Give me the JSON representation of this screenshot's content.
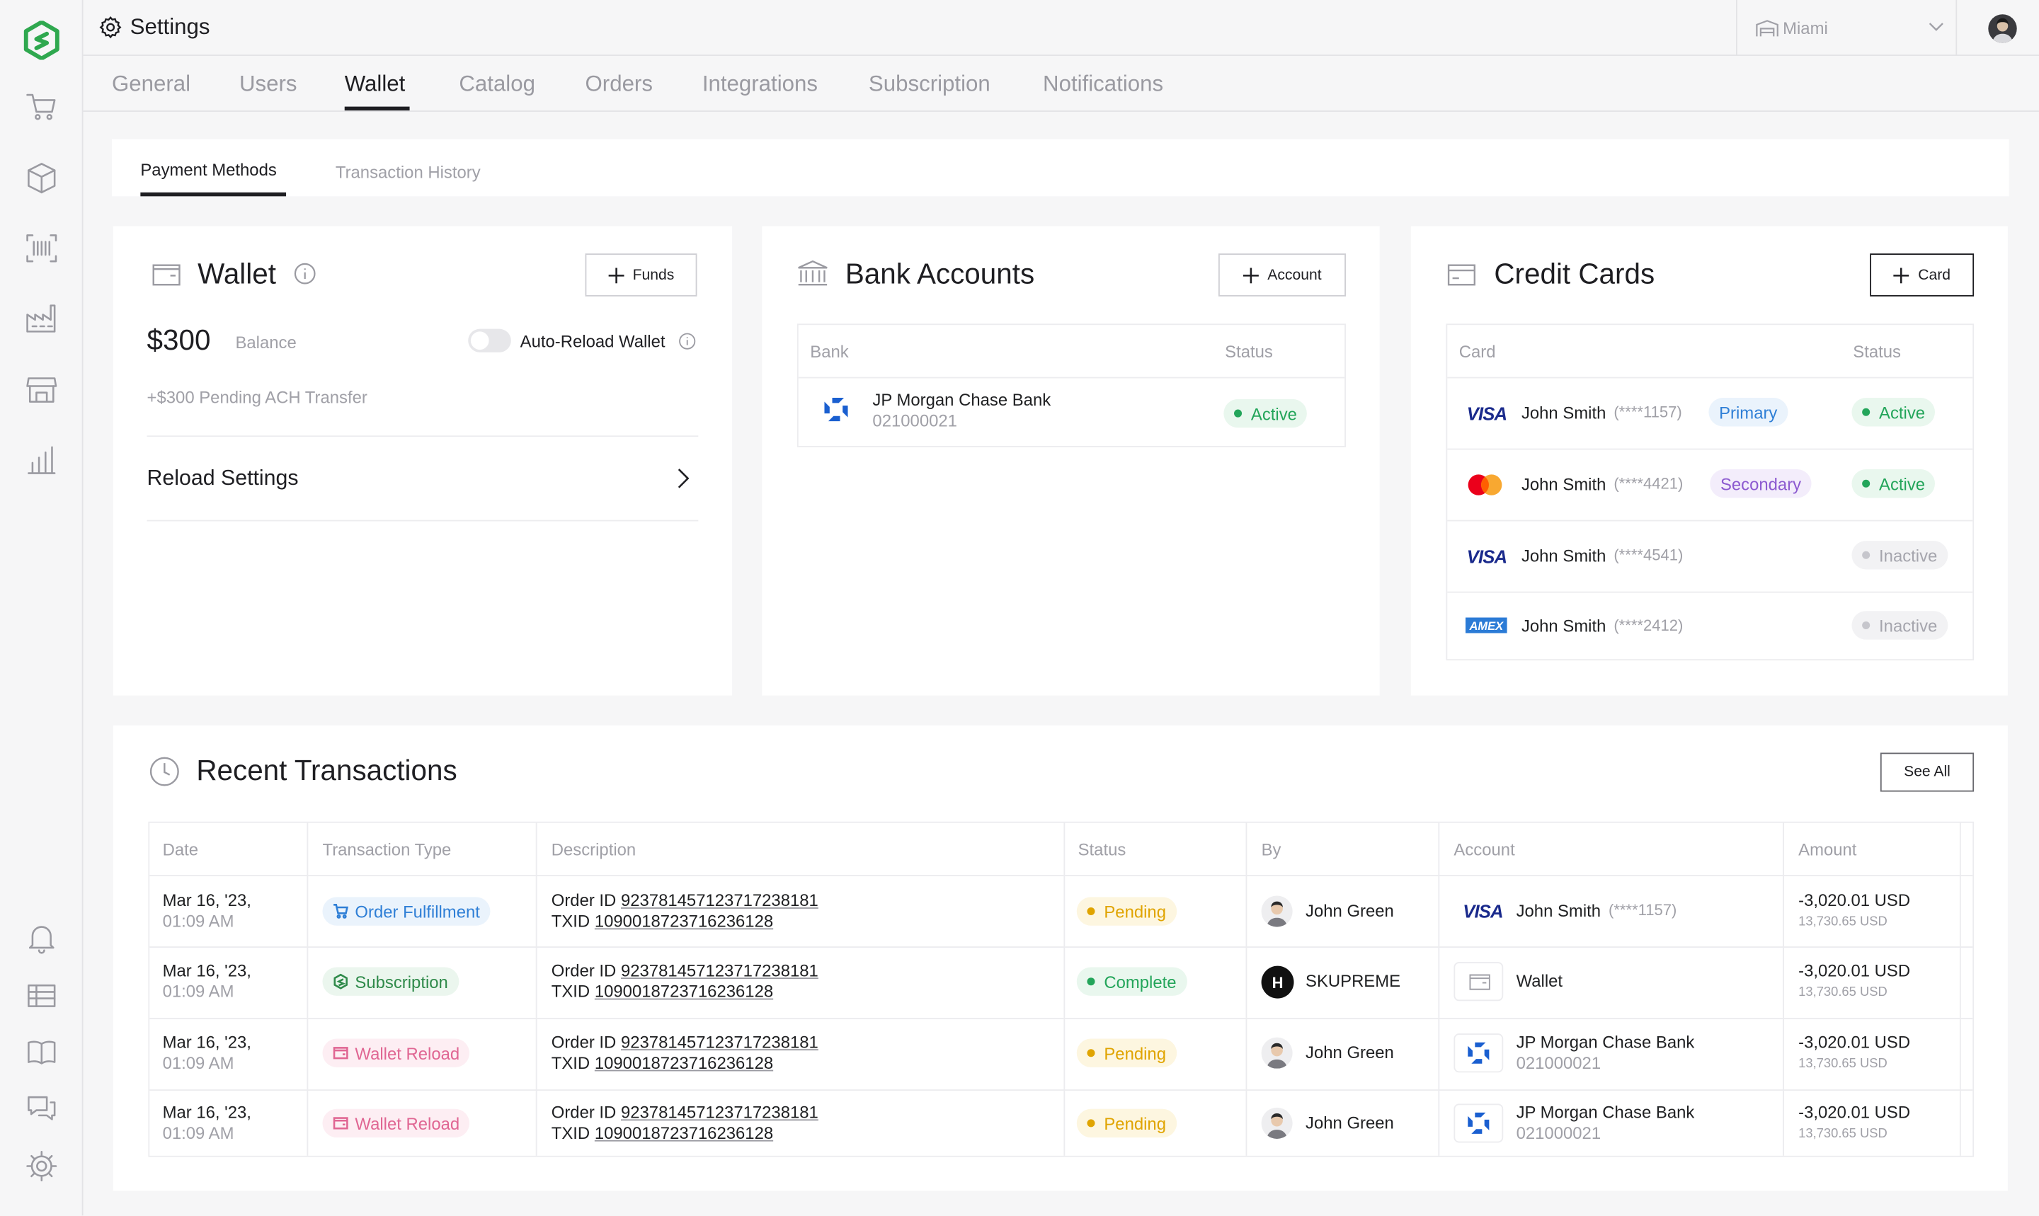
{
  "topbar": {
    "title": "Settings",
    "location": "Miami"
  },
  "tabs": [
    {
      "label": "General"
    },
    {
      "label": "Users"
    },
    {
      "label": "Wallet"
    },
    {
      "label": "Catalog"
    },
    {
      "label": "Orders"
    },
    {
      "label": "Integrations"
    },
    {
      "label": "Subscription"
    },
    {
      "label": "Notifications"
    }
  ],
  "subtabs": [
    {
      "label": "Payment Methods"
    },
    {
      "label": "Transaction History"
    }
  ],
  "wallet": {
    "title": "Wallet",
    "funds_button": "Funds",
    "balance": "$300",
    "balance_label": "Balance",
    "auto_reload_label": "Auto-Reload Wallet",
    "pending": "+$300 Pending ACH Transfer",
    "reload_settings": "Reload Settings"
  },
  "bank": {
    "title": "Bank Accounts",
    "add_button": "Account",
    "col_bank": "Bank",
    "col_status": "Status",
    "rows": [
      {
        "name": "JP Morgan Chase Bank",
        "number": "021000021",
        "status": "Active"
      }
    ]
  },
  "cards": {
    "title": "Credit Cards",
    "add_button": "Card",
    "col_card": "Card",
    "col_status": "Status",
    "rows": [
      {
        "brand": "VISA",
        "name": "John Smith",
        "mask": "(****1157)",
        "role": "Primary",
        "status": "Active"
      },
      {
        "brand": "mastercard",
        "name": "John Smith",
        "mask": "(****4421)",
        "role": "Secondary",
        "status": "Active"
      },
      {
        "brand": "VISA",
        "name": "John Smith",
        "mask": "(****4541)",
        "role": "",
        "status": "Inactive"
      },
      {
        "brand": "AMEX",
        "name": "John Smith",
        "mask": "(****2412)",
        "role": "",
        "status": "Inactive"
      }
    ]
  },
  "transactions": {
    "title": "Recent Transactions",
    "see_all": "See All",
    "columns": [
      "Date",
      "Transaction Type",
      "Description",
      "Status",
      "By",
      "Account",
      "Amount"
    ],
    "rows": [
      {
        "date": "Mar 16, '23,",
        "time": "01:09 AM",
        "type": "Order Fulfillment",
        "order_prefix": "Order ID",
        "order_id": "92378145712371723​8181",
        "tx_prefix": "TXID",
        "txid": "1090018723716236128",
        "status": "Pending",
        "by": "John Green",
        "account": "John Smith",
        "account_sub": "(****1157)",
        "amount": "-3,020.01 USD",
        "amount_sub": "13,730.65 USD"
      },
      {
        "date": "Mar 16, '23,",
        "time": "01:09 AM",
        "type": "Subscription",
        "order_prefix": "Order ID",
        "order_id": "92378145712371723​8181",
        "tx_prefix": "TXID",
        "txid": "1090018723716236128",
        "status": "Complete",
        "by": "SKUPREME",
        "account": "Wallet",
        "account_sub": "",
        "amount": "-3,020.01 USD",
        "amount_sub": "13,730.65 USD"
      },
      {
        "date": "Mar 16, '23,",
        "time": "01:09 AM",
        "type": "Wallet Reload",
        "order_prefix": "Order ID",
        "order_id": "92378145712371723​8181",
        "tx_prefix": "TXID",
        "txid": "1090018723716236128",
        "status": "Pending",
        "by": "John Green",
        "account": "JP Morgan Chase Bank",
        "account_sub": "021000021",
        "amount": "-3,020.01 USD",
        "amount_sub": "13,730.65 USD"
      },
      {
        "date": "Mar 16, '23,",
        "time": "01:09 AM",
        "type": "Wallet Reload",
        "order_prefix": "Order ID",
        "order_id": "92378145712371723​8181",
        "tx_prefix": "TXID",
        "txid": "1090018723716236128",
        "status": "Pending",
        "by": "John Green",
        "account": "JP Morgan Chase Bank",
        "account_sub": "021000021",
        "amount": "-3,020.01 USD",
        "amount_sub": "13,730.65 USD"
      }
    ]
  },
  "colors": {
    "brand": "#2fa84f",
    "active": "#23a55a",
    "pending": "#e0a400",
    "primary": "#2f7fd6",
    "secondary": "#8c5ad0",
    "order_fulfillment": "#2f7fd6",
    "subscription": "#2f8a4a",
    "wallet_reload": "#e06693"
  },
  "icons": [
    "logo-icon",
    "cart-icon",
    "box-icon",
    "barcode-icon",
    "factory-icon",
    "store-icon",
    "chart-icon",
    "bell-icon",
    "list-icon",
    "book-icon",
    "chat-icon",
    "gear-icon"
  ]
}
